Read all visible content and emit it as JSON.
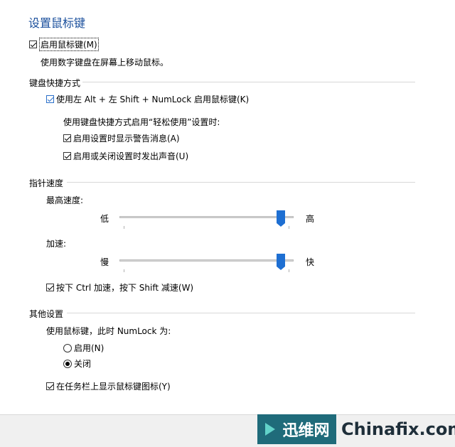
{
  "title": "设置鼠标键",
  "main_checkbox": {
    "label": "启用鼠标键(M)",
    "checked": true
  },
  "main_description": "使用数字键盘在屏幕上移动鼠标。",
  "keyboard_shortcut": {
    "group_title": "键盘快捷方式",
    "shortcut_checkbox": {
      "label": "使用左 Alt + 左 Shift + NumLock 启用鼠标键(K)",
      "checked": true
    },
    "subtitle": "使用键盘快捷方式启用“轻松使用”设置时:",
    "warning_checkbox": {
      "label": "启用设置时显示警告消息(A)",
      "checked": true
    },
    "sound_checkbox": {
      "label": "启用或关闭设置时发出声音(U)",
      "checked": true
    }
  },
  "pointer_speed": {
    "group_title": "指针速度",
    "top_speed_label": "最高速度:",
    "top_speed_low": "低",
    "top_speed_high": "高",
    "top_speed_value": 0.95,
    "accel_label": "加速:",
    "accel_low": "慢",
    "accel_high": "快",
    "accel_value": 0.95,
    "ctrl_checkbox": {
      "label": "按下 Ctrl 加速，按下 Shift 减速(W)",
      "checked": true
    }
  },
  "other_settings": {
    "group_title": "其他设置",
    "numlock_label": "使用鼠标键，此时 NumLock 为:",
    "radio_on": {
      "label": "启用(N)",
      "selected": false
    },
    "radio_off": {
      "label": "关闭",
      "selected": true
    },
    "taskbar_checkbox": {
      "label": "在任务栏上显示鼠标键图标(Y)",
      "checked": true
    }
  },
  "watermark": {
    "cn": "迅维网",
    "en": "Chinafix.com"
  }
}
